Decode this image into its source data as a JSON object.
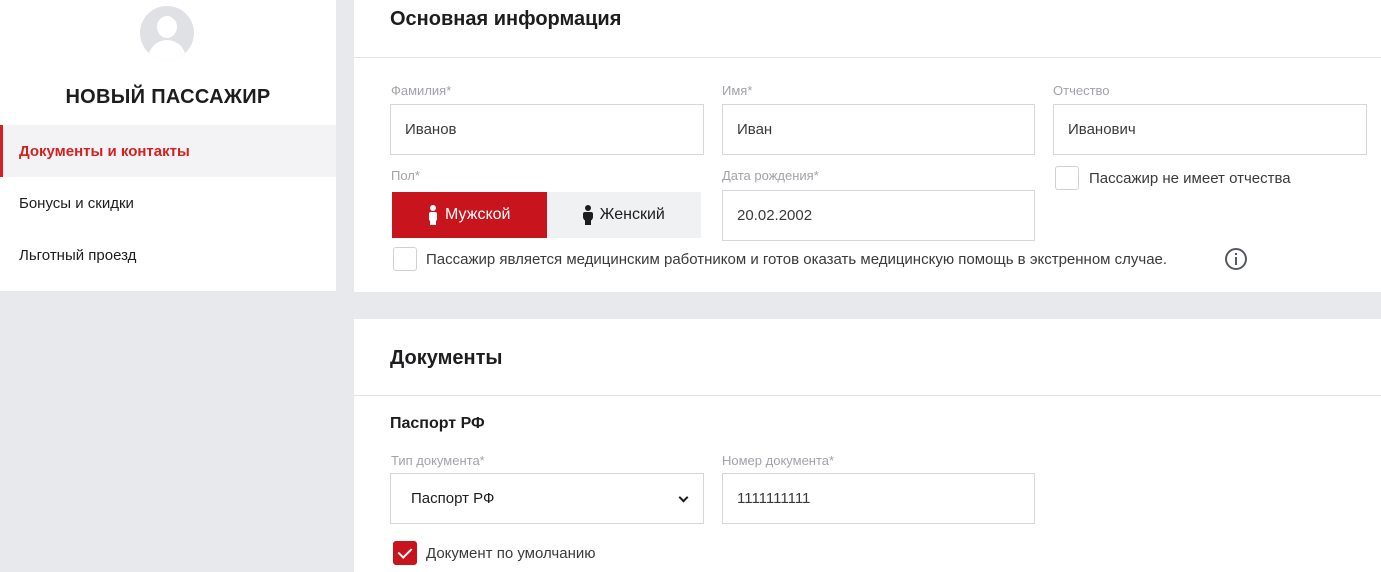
{
  "sidebar": {
    "title": "НОВЫЙ ПАССАЖИР",
    "items": [
      {
        "label": "Документы и контакты",
        "active": true
      },
      {
        "label": "Бонусы и скидки",
        "active": false
      },
      {
        "label": "Льготный проезд",
        "active": false
      }
    ]
  },
  "main_info": {
    "title": "Основная информация",
    "last_name": {
      "label": "Фамилия*",
      "value": "Иванов"
    },
    "first_name": {
      "label": "Имя*",
      "value": "Иван"
    },
    "patronymic": {
      "label": "Отчество",
      "value": "Иванович"
    },
    "no_patronymic": {
      "label": "Пассажир не имеет отчества",
      "checked": false
    },
    "gender": {
      "label": "Пол*",
      "male": "Мужской",
      "female": "Женский",
      "selected": "male"
    },
    "birth_date": {
      "label": "Дата рождения*",
      "value": "20.02.2002"
    },
    "medical_worker": {
      "label": "Пассажир является медицинским работником и готов оказать медицинскую помощь в экстренном случае.",
      "checked": false
    }
  },
  "documents": {
    "title": "Документы",
    "passport_title": "Паспорт РФ",
    "doc_type": {
      "label": "Тип документа*",
      "value": "Паспорт РФ"
    },
    "doc_number": {
      "label": "Номер документа*",
      "value": "1111111111"
    },
    "default_doc": {
      "label": "Документ по умолчанию",
      "checked": true
    }
  },
  "colors": {
    "accent": "#c8141c",
    "active_text": "#d42020",
    "background": "#e8e9ec"
  }
}
